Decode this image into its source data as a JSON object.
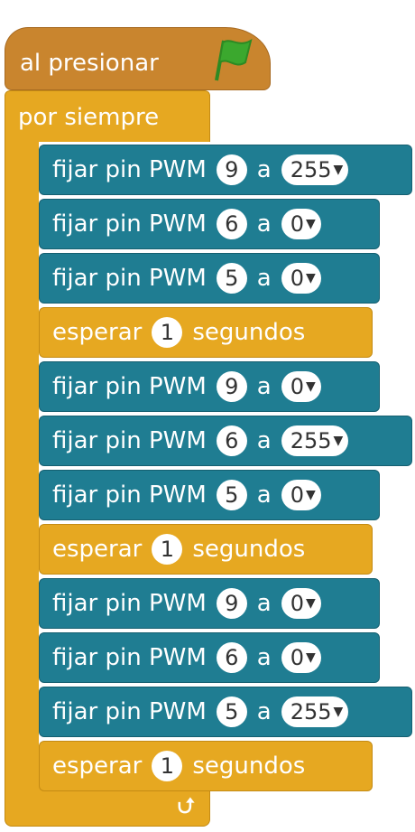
{
  "hat": {
    "label": "al presionar",
    "flag_icon": "green-flag-icon"
  },
  "loop": {
    "label": "por siempre",
    "arrow_icon": "loop-arrow-icon"
  },
  "blocks": [
    {
      "type": "pwm",
      "label": "fijar pin PWM",
      "pin": "9",
      "a": "a",
      "value": "255"
    },
    {
      "type": "pwm",
      "label": "fijar pin PWM",
      "pin": "6",
      "a": "a",
      "value": "0"
    },
    {
      "type": "pwm",
      "label": "fijar pin PWM",
      "pin": "5",
      "a": "a",
      "value": "0"
    },
    {
      "type": "wait",
      "label": "esperar",
      "seconds": "1",
      "unit": "segundos"
    },
    {
      "type": "pwm",
      "label": "fijar pin PWM",
      "pin": "9",
      "a": "a",
      "value": "0"
    },
    {
      "type": "pwm",
      "label": "fijar pin PWM",
      "pin": "6",
      "a": "a",
      "value": "255"
    },
    {
      "type": "pwm",
      "label": "fijar pin PWM",
      "pin": "5",
      "a": "a",
      "value": "0"
    },
    {
      "type": "wait",
      "label": "esperar",
      "seconds": "1",
      "unit": "segundos"
    },
    {
      "type": "pwm",
      "label": "fijar pin PWM",
      "pin": "9",
      "a": "a",
      "value": "0"
    },
    {
      "type": "pwm",
      "label": "fijar pin PWM",
      "pin": "6",
      "a": "a",
      "value": "0"
    },
    {
      "type": "pwm",
      "label": "fijar pin PWM",
      "pin": "5",
      "a": "a",
      "value": "255"
    },
    {
      "type": "wait",
      "label": "esperar",
      "seconds": "1",
      "unit": "segundos"
    }
  ],
  "colors": {
    "event": "#C9852E",
    "control": "#E6A821",
    "pwm": "#1F7D92",
    "flag": "#3BA82E"
  }
}
